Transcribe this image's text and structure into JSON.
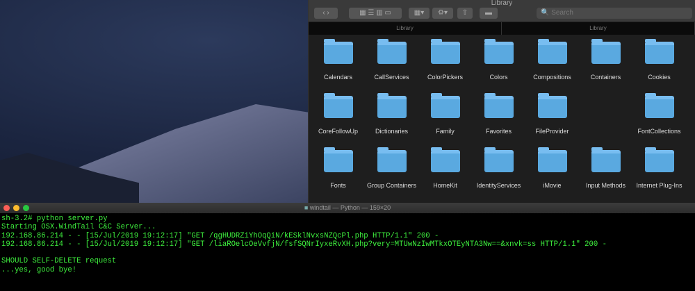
{
  "finder": {
    "title": "Library",
    "search_placeholder": "Search",
    "tabs": [
      "Library",
      "Library"
    ],
    "items": [
      [
        "Calendars",
        "CallServices",
        "ColorPickers",
        "Colors",
        "Compositions",
        "Containers",
        "Cookies"
      ],
      [
        "CoreFollowUp",
        "Dictionaries",
        "Family",
        "Favorites",
        "FileProvider",
        "",
        "FontCollections"
      ],
      [
        "Fonts",
        "Group Containers",
        "HomeKit",
        "IdentityServices",
        "iMovie",
        "Input Methods",
        "Internet Plug-Ins"
      ]
    ]
  },
  "terminal": {
    "title": "windtail — Python — 159×20",
    "lines": [
      "sh-3.2# python server.py",
      "Starting OSX.WindTail C&C Server...",
      "192.168.86.214 - - [15/Jul/2019 19:12:17] \"GET /qgHUDRZiYhOqQiN/kESklNvxsNZQcPl.php HTTP/1.1\" 200 -",
      "192.168.86.214 - - [15/Jul/2019 19:12:17] \"GET /liaROelcOeVvfjN/fsfSQNrIyxeRvXH.php?very=MTUwNzIwMTkxOTEyNTA3Nw==&xnvk=ss HTTP/1.1\" 200 -",
      "",
      "SHOULD SELF-DELETE request",
      "...yes, good bye!"
    ]
  }
}
